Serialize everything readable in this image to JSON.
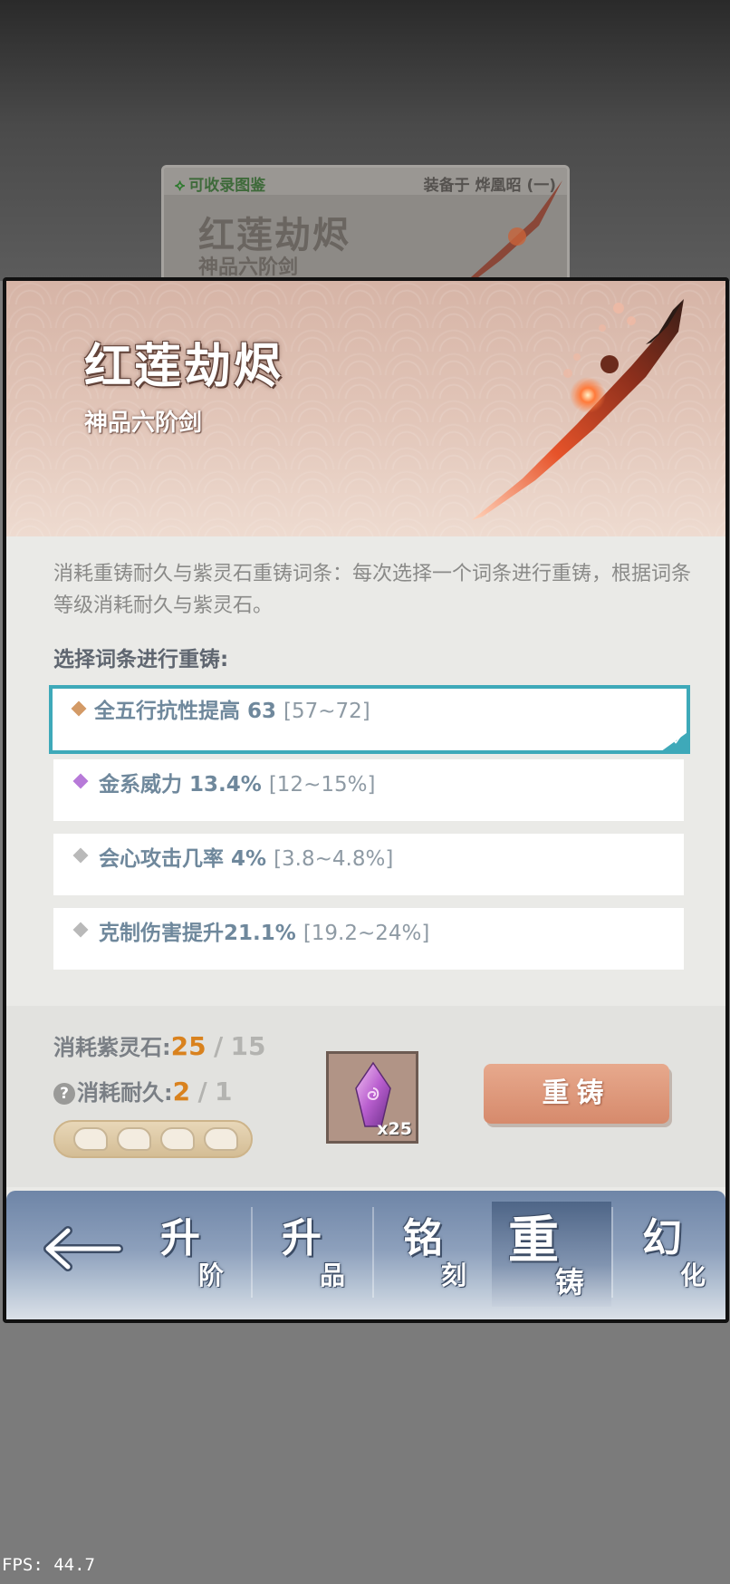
{
  "background_card": {
    "collect_tag": "可收录图鉴",
    "equipped_label": "装备于 烨凰昭 (一)",
    "title": "红莲劫烬",
    "subtitle": "神品六阶剑"
  },
  "item": {
    "name": "红莲劫烬",
    "subtitle": "神品六阶剑"
  },
  "description": "消耗重铸耐久与紫灵石重铸词条：每次选择一个词条进行重铸，根据词条等级消耗耐久与紫灵石。",
  "section_label": "选择词条进行重铸:",
  "affixes": [
    {
      "name": "全五行抗性提高 63",
      "range": "[57~72]",
      "quality_color": "#d39a66",
      "selected": true
    },
    {
      "name": "金系威力 13.4%",
      "range": "[12~15%]",
      "quality_color": "#b77ad8",
      "selected": false
    },
    {
      "name": "会心攻击几率 4%",
      "range": "[3.8~4.8%]",
      "quality_color": "#b9b9b9",
      "selected": false
    },
    {
      "name": "克制伤害提升21.1%",
      "range": "[19.2~24%]",
      "quality_color": "#b9b9b9",
      "selected": false
    }
  ],
  "cost": {
    "stone_label": "消耗紫灵石:",
    "stone_current": "25",
    "stone_required": "15",
    "durability_label": "消耗耐久:",
    "durability_current": "2",
    "durability_required": "1",
    "separator": "/",
    "help_glyph": "?",
    "durability_pips_total": 4,
    "stone_item_count": "x25"
  },
  "recast_button": "重铸",
  "nav": {
    "tabs": [
      {
        "big": "升",
        "small": "阶",
        "active": false
      },
      {
        "big": "升",
        "small": "品",
        "active": false
      },
      {
        "big": "铭",
        "small": "刻",
        "active": false
      },
      {
        "big": "重",
        "small": "铸",
        "active": true
      },
      {
        "big": "幻",
        "small": "化",
        "active": false
      }
    ]
  },
  "fps": "FPS: 44.7",
  "colors": {
    "accent_teal": "#3ea9b9",
    "stone_current": "#d9821e",
    "affix_text": "#6f889c"
  }
}
